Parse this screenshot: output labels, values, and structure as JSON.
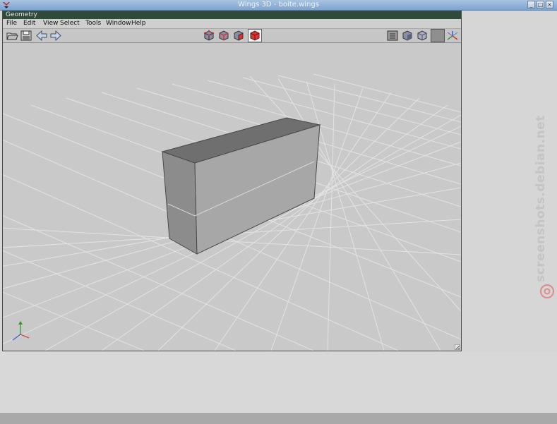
{
  "window": {
    "title": "Wings 3D - boite.wings"
  },
  "geometry_panel": {
    "title": "Geometry"
  },
  "menu": {
    "items": [
      "File",
      "Edit",
      "View",
      "Select",
      "Tools",
      "Window",
      "Help"
    ]
  },
  "toolbar": {
    "left_icons": [
      "open-folder-icon",
      "save-icon",
      "undo-arrow-icon",
      "redo-arrow-icon"
    ],
    "center_icons": [
      "vertex-select-icon",
      "edge-select-icon",
      "face-select-icon",
      "object-select-icon"
    ],
    "right_icons": [
      "groundplane-icon",
      "shaded-cube-icon",
      "smooth-cube-icon",
      "wireframe-icon",
      "axes-icon"
    ]
  },
  "watermark": {
    "text": "screenshots.debian.net"
  },
  "colors": {
    "selected_mode": "#e03030",
    "header_bg": "#2f4a3b",
    "viewport_bg": "#c9c9c9"
  }
}
